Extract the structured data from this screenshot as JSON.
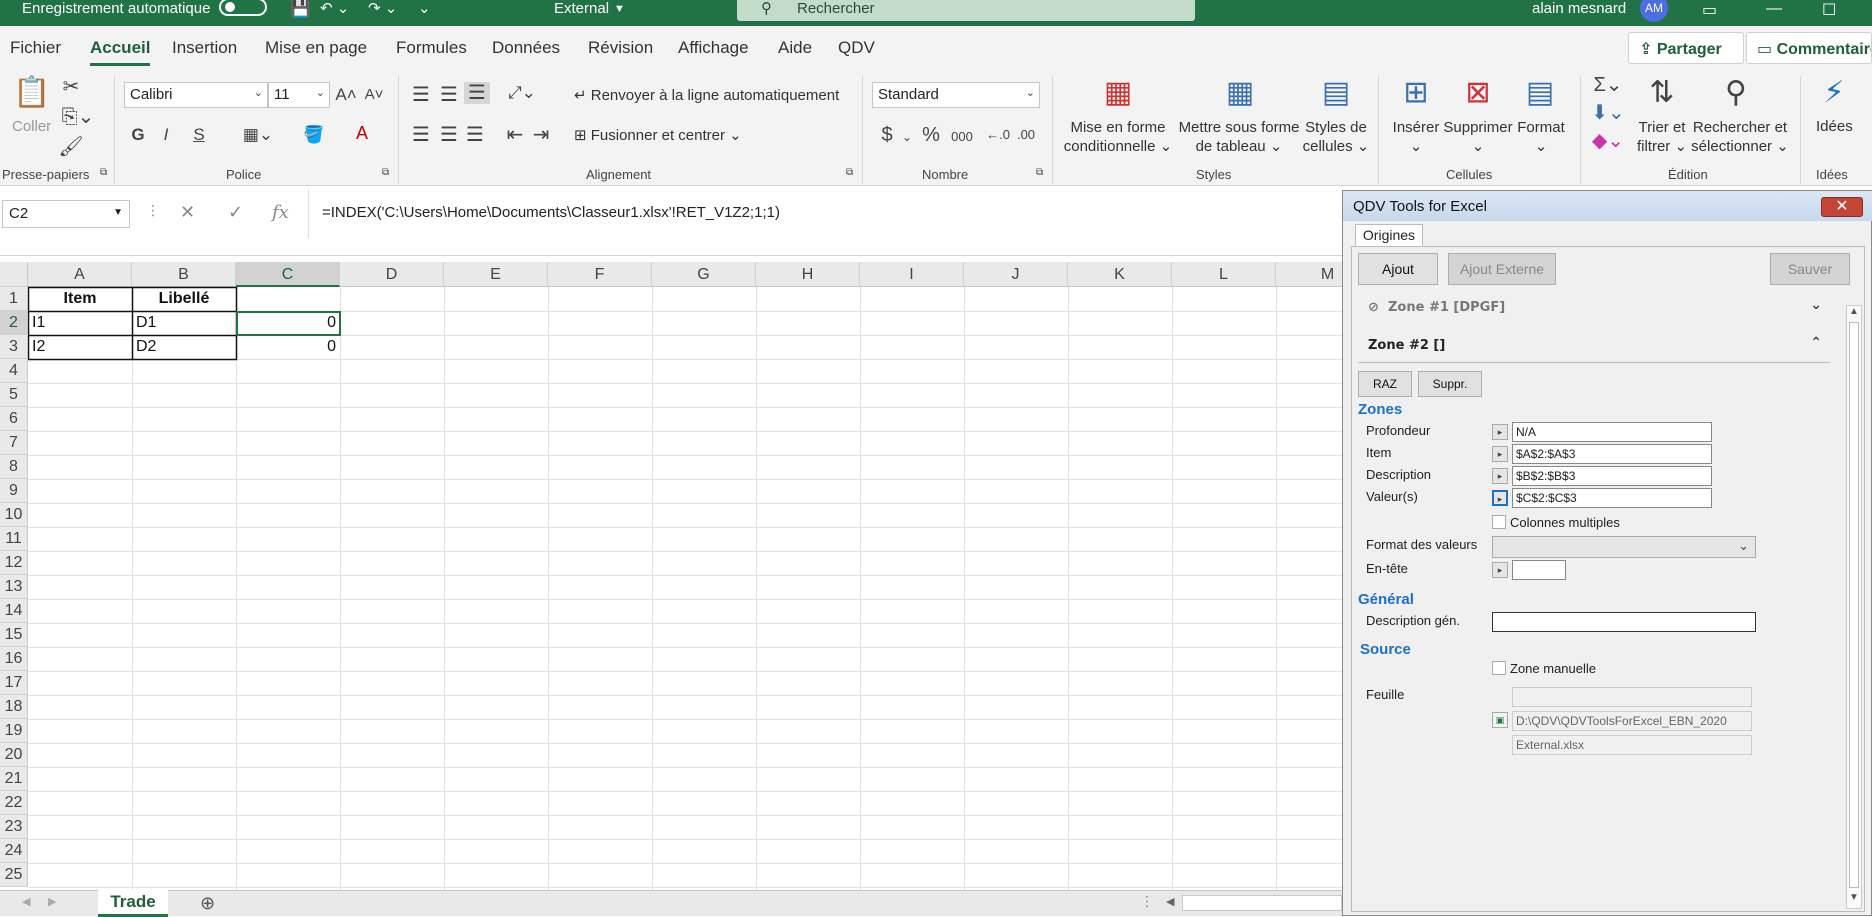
{
  "titlebar": {
    "autosave_label": "Enregistrement automatique",
    "filename": "External",
    "search_placeholder": "Rechercher",
    "user_name": "alain mesnard",
    "user_initials": "AM"
  },
  "menu": {
    "tabs": [
      "Fichier",
      "Accueil",
      "Insertion",
      "Mise en page",
      "Formules",
      "Données",
      "Révision",
      "Affichage",
      "Aide",
      "QDV"
    ],
    "active_tab": "Accueil",
    "share_label": "Partager",
    "comments_label": "Commentaires"
  },
  "ribbon": {
    "clipboard": {
      "paste_label": "Coller",
      "group_label": "Presse-papiers"
    },
    "font": {
      "family": "Calibri",
      "size": "11",
      "group_label": "Police",
      "bold": "G",
      "italic": "I",
      "underline": "S"
    },
    "alignment": {
      "wrap_label": "Renvoyer à la ligne automatiquement",
      "merge_label": "Fusionner et centrer",
      "group_label": "Alignement"
    },
    "number": {
      "format": "Standard",
      "group_label": "Nombre",
      "currency": "$",
      "percent": "%",
      "thousands": "000"
    },
    "styles": {
      "conditional_label_1": "Mise en forme",
      "conditional_label_2": "conditionnelle",
      "table_label_1": "Mettre sous forme",
      "table_label_2": "de tableau",
      "cellstyles_label_1": "Styles de",
      "cellstyles_label_2": "cellules",
      "group_label": "Styles"
    },
    "cells": {
      "insert_label": "Insérer",
      "delete_label": "Supprimer",
      "format_label": "Format",
      "group_label": "Cellules"
    },
    "editing": {
      "sort_label_1": "Trier et",
      "sort_label_2": "filtrer",
      "find_label_1": "Rechercher et",
      "find_label_2": "sélectionner",
      "group_label": "Édition"
    },
    "ideas": {
      "label": "Idées",
      "group_label": "Idées"
    }
  },
  "formula_bar": {
    "name_box": "C2",
    "formula": "=INDEX('C:\\Users\\Home\\Documents\\Classeur1.xlsx'!RET_V1Z2;1;1)"
  },
  "grid": {
    "columns": [
      "A",
      "B",
      "C",
      "D",
      "E",
      "F",
      "G",
      "H",
      "I",
      "J",
      "K",
      "L",
      "M"
    ],
    "selected_column": "C",
    "rows": [
      "1",
      "2",
      "3",
      "4",
      "5",
      "6",
      "7",
      "8",
      "9",
      "10",
      "11",
      "12",
      "13",
      "14",
      "15",
      "16",
      "17",
      "18",
      "19",
      "20",
      "21",
      "22",
      "23",
      "24",
      "25"
    ],
    "cells": {
      "A1": "Item",
      "B1": "Libellé",
      "A2": "I1",
      "B2": "D1",
      "C2": "0",
      "A3": "I2",
      "B3": "D2",
      "C3": "0"
    }
  },
  "sheets": {
    "tabs": [
      "Trade"
    ],
    "active": "Trade"
  },
  "qdv_panel": {
    "title": "QDV Tools for Excel",
    "tab": "Origines",
    "add_label": "Ajout",
    "add_external_label": "Ajout Externe",
    "save_label": "Sauver",
    "zone1_label": "Zone #1 [DPGF]",
    "zone2_label": "Zone #2 []",
    "reset_label": "RAZ",
    "delete_label": "Suppr.",
    "section_zones": "Zones",
    "depth_label": "Profondeur",
    "depth_value": "N/A",
    "item_label": "Item",
    "item_value": "$A$2:$A$3",
    "description_label": "Description",
    "description_value": "$B$2:$B$3",
    "values_label": "Valeur(s)",
    "values_value": "$C$2:$C$3",
    "multi_columns_label": "Colonnes multiples",
    "value_format_label": "Format des valeurs",
    "header_label": "En-tête",
    "section_general": "Général",
    "general_desc_label": "Description gén.",
    "section_source": "Source",
    "manual_zone_label": "Zone manuelle",
    "sheet_label": "Feuille",
    "path_value": "D:\\QDV\\QDVToolsForExcel_EBN_2020",
    "file_value": "External.xlsx"
  }
}
